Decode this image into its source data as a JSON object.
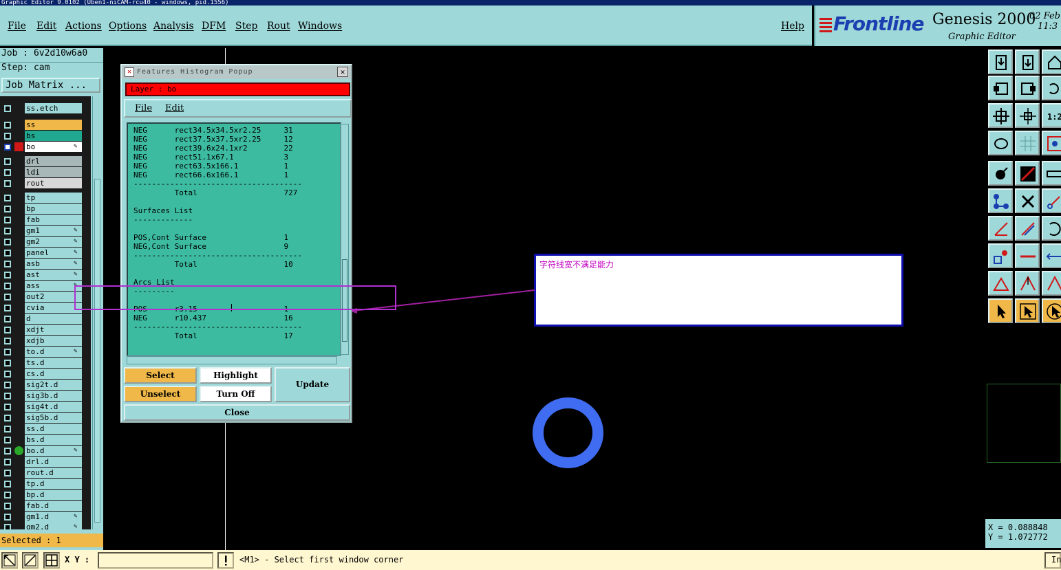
{
  "window": {
    "title": "Graphic Editor 9.0102 (Uben1-niCAM-rcu40 - windows, pid.1556)"
  },
  "menu": [
    "File",
    "Edit",
    "Actions",
    "Options",
    "Analysis",
    "DFM",
    "Step",
    "Rout",
    "Windows"
  ],
  "help_label": "Help",
  "brand": {
    "logo": "Frontline",
    "product": "Genesis 2000",
    "subtitle": "Graphic Editor",
    "date": "02 Feb",
    "time": "11:3"
  },
  "left": {
    "job": "Job : 6v2d10w6a0",
    "step": "Step: cam",
    "job_matrix": "Job Matrix ...",
    "layers": [
      {
        "name": "ss.etch",
        "color": "#9ed8d8"
      },
      {
        "name": "ss",
        "color": "#f0b848"
      },
      {
        "name": "bs",
        "color": "#20a890"
      },
      {
        "name": "bo",
        "color": "#ffffff",
        "active": true
      },
      {
        "name": "drl",
        "color": "#a8b8b8"
      },
      {
        "name": "ldi",
        "color": "#a8b8b8"
      },
      {
        "name": "rout",
        "color": "#d8d8d8"
      },
      {
        "name": "tp",
        "color": "#9ed8d8"
      },
      {
        "name": "bp",
        "color": "#9ed8d8"
      },
      {
        "name": "fab",
        "color": "#9ed8d8"
      },
      {
        "name": "gm1",
        "color": "#9ed8d8"
      },
      {
        "name": "gm2",
        "color": "#9ed8d8"
      },
      {
        "name": "panel",
        "color": "#9ed8d8"
      },
      {
        "name": "asb",
        "color": "#9ed8d8"
      },
      {
        "name": "ast",
        "color": "#9ed8d8"
      },
      {
        "name": "ass",
        "color": "#9ed8d8"
      },
      {
        "name": "out2",
        "color": "#9ed8d8"
      },
      {
        "name": "cvia",
        "color": "#9ed8d8"
      },
      {
        "name": "d",
        "color": "#9ed8d8"
      },
      {
        "name": "xdjt",
        "color": "#9ed8d8"
      },
      {
        "name": "xdjb",
        "color": "#9ed8d8"
      },
      {
        "name": "to.d",
        "color": "#9ed8d8"
      },
      {
        "name": "ts.d",
        "color": "#9ed8d8"
      },
      {
        "name": "cs.d",
        "color": "#9ed8d8"
      },
      {
        "name": "sig2t.d",
        "color": "#9ed8d8"
      },
      {
        "name": "sig3b.d",
        "color": "#9ed8d8"
      },
      {
        "name": "sig4t.d",
        "color": "#9ed8d8"
      },
      {
        "name": "sig5b.d",
        "color": "#9ed8d8"
      },
      {
        "name": "ss.d",
        "color": "#9ed8d8"
      },
      {
        "name": "bs.d",
        "color": "#9ed8d8"
      },
      {
        "name": "bo.d",
        "color": "#9ed8d8",
        "dot": true
      },
      {
        "name": "drl.d",
        "color": "#9ed8d8"
      },
      {
        "name": "rout.d",
        "color": "#9ed8d8"
      },
      {
        "name": "tp.d",
        "color": "#9ed8d8"
      },
      {
        "name": "bp.d",
        "color": "#9ed8d8"
      },
      {
        "name": "fab.d",
        "color": "#9ed8d8"
      },
      {
        "name": "gm1.d",
        "color": "#9ed8d8"
      },
      {
        "name": "gm2.d",
        "color": "#9ed8d8"
      }
    ],
    "selected": "Selected : 1"
  },
  "popup": {
    "title": "Features Histogram Popup",
    "layer": "Layer :  bo",
    "menu": [
      "File",
      "Edit"
    ],
    "lines": [
      "NEG      rect34.5x34.5xr2.25     31",
      "NEG      rect37.5x37.5xr2.25     12",
      "NEG      rect39.6x24.1xr2        22",
      "NEG      rect51.1x67.1           3",
      "NEG      rect63.5x166.1          1",
      "NEG      rect66.6x166.1          1",
      "-------------------------------------",
      "         Total                   727",
      "",
      "Surfaces List",
      "-------------",
      "",
      "POS,Cont Surface                 1",
      "NEG,Cont Surface                 9",
      "-------------------------------------",
      "         Total                   10",
      "",
      "Arcs List",
      "---------",
      "",
      "POS      r3.15                   1",
      "NEG      r10.437                 16",
      "-------------------------------------",
      "         Total                   17"
    ],
    "buttons": {
      "select": "Select",
      "highlight": "Highlight",
      "update": "Update",
      "unselect": "Unselect",
      "turn_off": "Turn Off",
      "close": "Close"
    }
  },
  "annotation": {
    "text": "字符线宽不满足能力"
  },
  "coords": {
    "x": "X = 0.088848",
    "y": "Y = 1.072772"
  },
  "status": {
    "xy_label": "X Y :",
    "xy_value": "",
    "prompt": "<M1> - Select first window corner",
    "right_tab": "In"
  },
  "colors": {
    "panel": "#9ed8d8",
    "accent_orange": "#f0b848",
    "layer_red": "#ff0000",
    "ring_blue": "#3f6cf0",
    "annotation_text": "#c000c0"
  }
}
